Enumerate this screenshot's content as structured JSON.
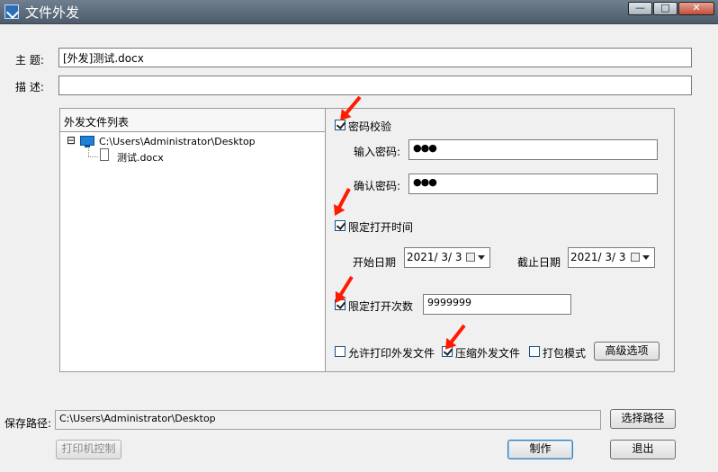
{
  "window": {
    "title": "文件外发",
    "controls": {
      "minimize": "—",
      "maximize": "□",
      "close": "✕"
    }
  },
  "form": {
    "subject_label": "主  题:",
    "subject_value": "[外发]测试.docx",
    "desc_label": "描  述:",
    "desc_value": ""
  },
  "file_list": {
    "title": "外发文件列表",
    "root": "C:\\Users\\Administrator\\Desktop",
    "toggle": "⊟",
    "children": [
      "测试.docx"
    ]
  },
  "options": {
    "password_check": {
      "label": "密码校验",
      "checked": true
    },
    "input_password_label": "输入密码:",
    "input_password_value": "●●●",
    "confirm_password_label": "确认密码:",
    "confirm_password_value": "●●●",
    "limit_open_time": {
      "label": "限定打开时间",
      "checked": true
    },
    "start_date_label": "开始日期",
    "start_date_value": "2021/ 3/ 3",
    "end_date_label": "截止日期",
    "end_date_value": "2021/ 3/ 3",
    "limit_open_count": {
      "label": "限定打开次数",
      "checked": true
    },
    "open_count_value": "9999999",
    "allow_print": {
      "label": "允许打印外发文件",
      "checked": false
    },
    "compress": {
      "label": "压缩外发文件",
      "checked": true
    },
    "pack_mode": {
      "label": "打包模式",
      "checked": false
    },
    "advanced_button": "高级选项"
  },
  "footer": {
    "save_path_label": "保存路径:",
    "save_path_value": "C:\\Users\\Administrator\\Desktop",
    "choose_path_button": "选择路径",
    "printer_control_button": "打印机控制",
    "make_button": "制作",
    "exit_button": "退出"
  },
  "colors": {
    "arrow": "#ff1a00",
    "titlebar": "#5a6877",
    "tree_icon": "#1e7fd6"
  }
}
